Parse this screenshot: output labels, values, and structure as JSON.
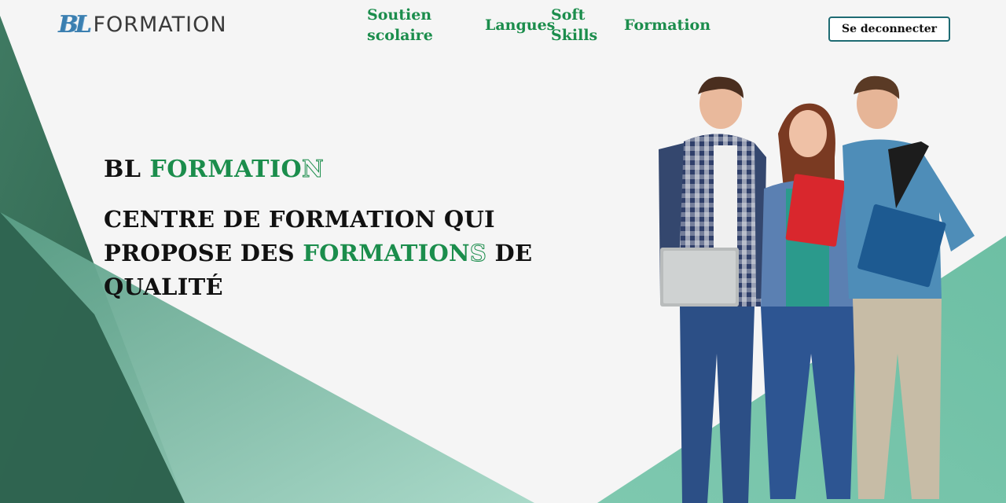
{
  "brand": {
    "logo_mark": "BL",
    "logo_text": "FORMATION"
  },
  "nav": {
    "soutien_line1": "Soutien",
    "soutien_line2": "scolaire",
    "langues": "Langues",
    "soft_line1": "Soft",
    "soft_line2": "Skills",
    "formation": "Formation"
  },
  "header": {
    "logout_label": "Se deconnecter"
  },
  "hero": {
    "brand_prefix": "BL ",
    "brand_green": "FORMATIO",
    "brand_outline": "N",
    "tagline_line1": "CENTRE DE FORMATION QUI",
    "tagline_line2_prefix": "PROPOSE DES ",
    "tagline_line2_green": "FORMATION",
    "tagline_line2_outline": "S",
    "tagline_line2_suffix": " DE",
    "tagline_line3": "QUALITÉ"
  },
  "colors": {
    "accent_green": "#1b8d4c",
    "dark_green": "#2f6b53",
    "mint": "#7cc5ad",
    "button_border": "#1e6b73",
    "background": "#f5f5f5"
  }
}
